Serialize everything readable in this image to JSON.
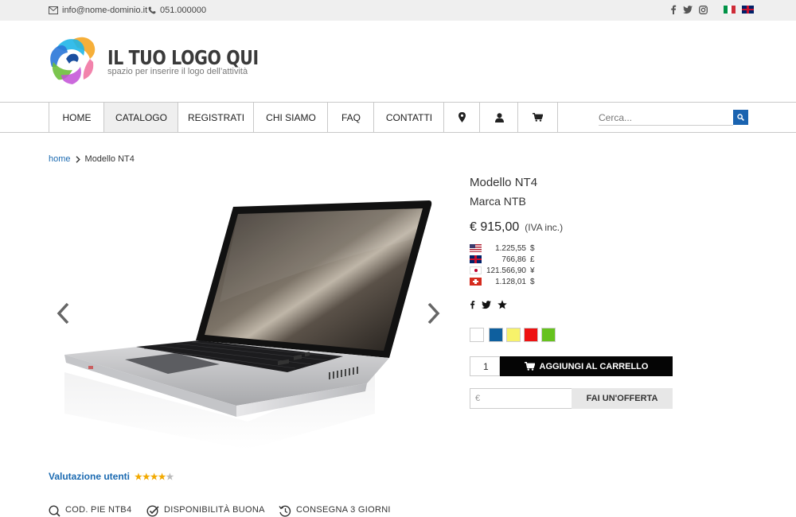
{
  "topbar": {
    "email": "info@nome-dominio.it",
    "phone": "051.000000"
  },
  "logo": {
    "title": "IL TUO LOGO QUI",
    "subtitle": "spazio per inserire il logo dell’attività"
  },
  "nav": {
    "items": [
      "HOME",
      "CATALOGO",
      "REGISTRATI",
      "CHI SIAMO",
      "FAQ",
      "CONTATTI"
    ],
    "active": "CATALOGO"
  },
  "search": {
    "placeholder": "Cerca..."
  },
  "breadcrumb": {
    "home": "home",
    "current": "Modello NT4"
  },
  "product": {
    "title": "Modello NT4",
    "brand": "Marca NTB",
    "price": "€ 915,00",
    "vat_note": "(IVA inc.)",
    "currencies": [
      {
        "flag": "us",
        "value": "1.225,55",
        "symbol": "$"
      },
      {
        "flag": "uk",
        "value": "766,86",
        "symbol": "£"
      },
      {
        "flag": "jp",
        "value": "121.566,90",
        "symbol": "¥"
      },
      {
        "flag": "ch",
        "value": "1.128,01",
        "symbol": "$"
      }
    ],
    "colors": [
      "#ffffff",
      "#0e5f9e",
      "#f7f26a",
      "#ee1111",
      "#66c21e"
    ],
    "quantity": "1",
    "add_to_cart": "AGGIUNGI AL CARRELLO",
    "offer_placeholder": "€",
    "offer_button": "FAI UN'OFFERTA"
  },
  "rating": {
    "label": "Valutazione utenti",
    "stars": 4,
    "max": 5,
    "star_color": "#f2a900"
  },
  "features": {
    "code": "COD. PIE NTB4",
    "availability": "DISPONIBILITÀ BUONA",
    "delivery": "CONSEGNA 3 GIORNI"
  },
  "colors": {
    "accent": "#1b6ab1",
    "topbar_bg": "#efefef",
    "cart_button": "#050505"
  }
}
